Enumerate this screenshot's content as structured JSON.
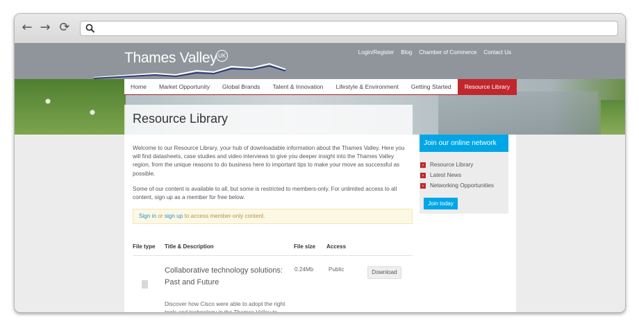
{
  "browser": {
    "back_icon": "arrow-left-icon",
    "forward_icon": "arrow-right-icon",
    "reload_icon": "reload-icon",
    "search_icon": "search-icon",
    "url_value": ""
  },
  "site": {
    "logo_text": "Thames Valley",
    "logo_badge": "UK",
    "top_links": [
      "Login/Register",
      "Blog",
      "Chamber of Commerce",
      "Contact Us"
    ]
  },
  "nav": {
    "items": [
      "Home",
      "Market Opportunity",
      "Global Brands",
      "Talent & Innovation",
      "Lifestyle & Environment",
      "Getting Started",
      "Resource Library"
    ],
    "active_index": 6
  },
  "page": {
    "title": "Resource Library",
    "intro": "Welcome to our Resource Library, your hub of downloadable information about the Thames Valley. Here you will find datasheets, case studies and video interviews to give you deeper insight into the Thames Valley region, from the unique reasons to do business here to important tips to make your move as successful as possible.",
    "members_text": "Some of our content is available to all, but some is restricted to members-only. For unlimited access to all content, sign up as a member for free below.",
    "notice": {
      "signin": "Sign in",
      "or": " or ",
      "signup": "sign up",
      "rest": " to access member-only content."
    }
  },
  "table": {
    "headers": [
      "File type",
      "Title & Description",
      "File size",
      "Access"
    ],
    "rows": [
      {
        "title": "Collaborative technology solutions: Past and Future",
        "description": "Discover how Cisco were able to adopt the right tools and technology in the Thames Valley to",
        "size": "0.24Mb",
        "access": "Public",
        "action": "Download"
      }
    ]
  },
  "sidebar": {
    "heading": "Join our online network",
    "links": [
      "Resource Library",
      "Latest News",
      "Networking Opportunities"
    ],
    "button": "Join today"
  },
  "colors": {
    "brand_red": "#c1272d",
    "accent_blue": "#00a6e6",
    "header_grey": "#8f959a"
  }
}
